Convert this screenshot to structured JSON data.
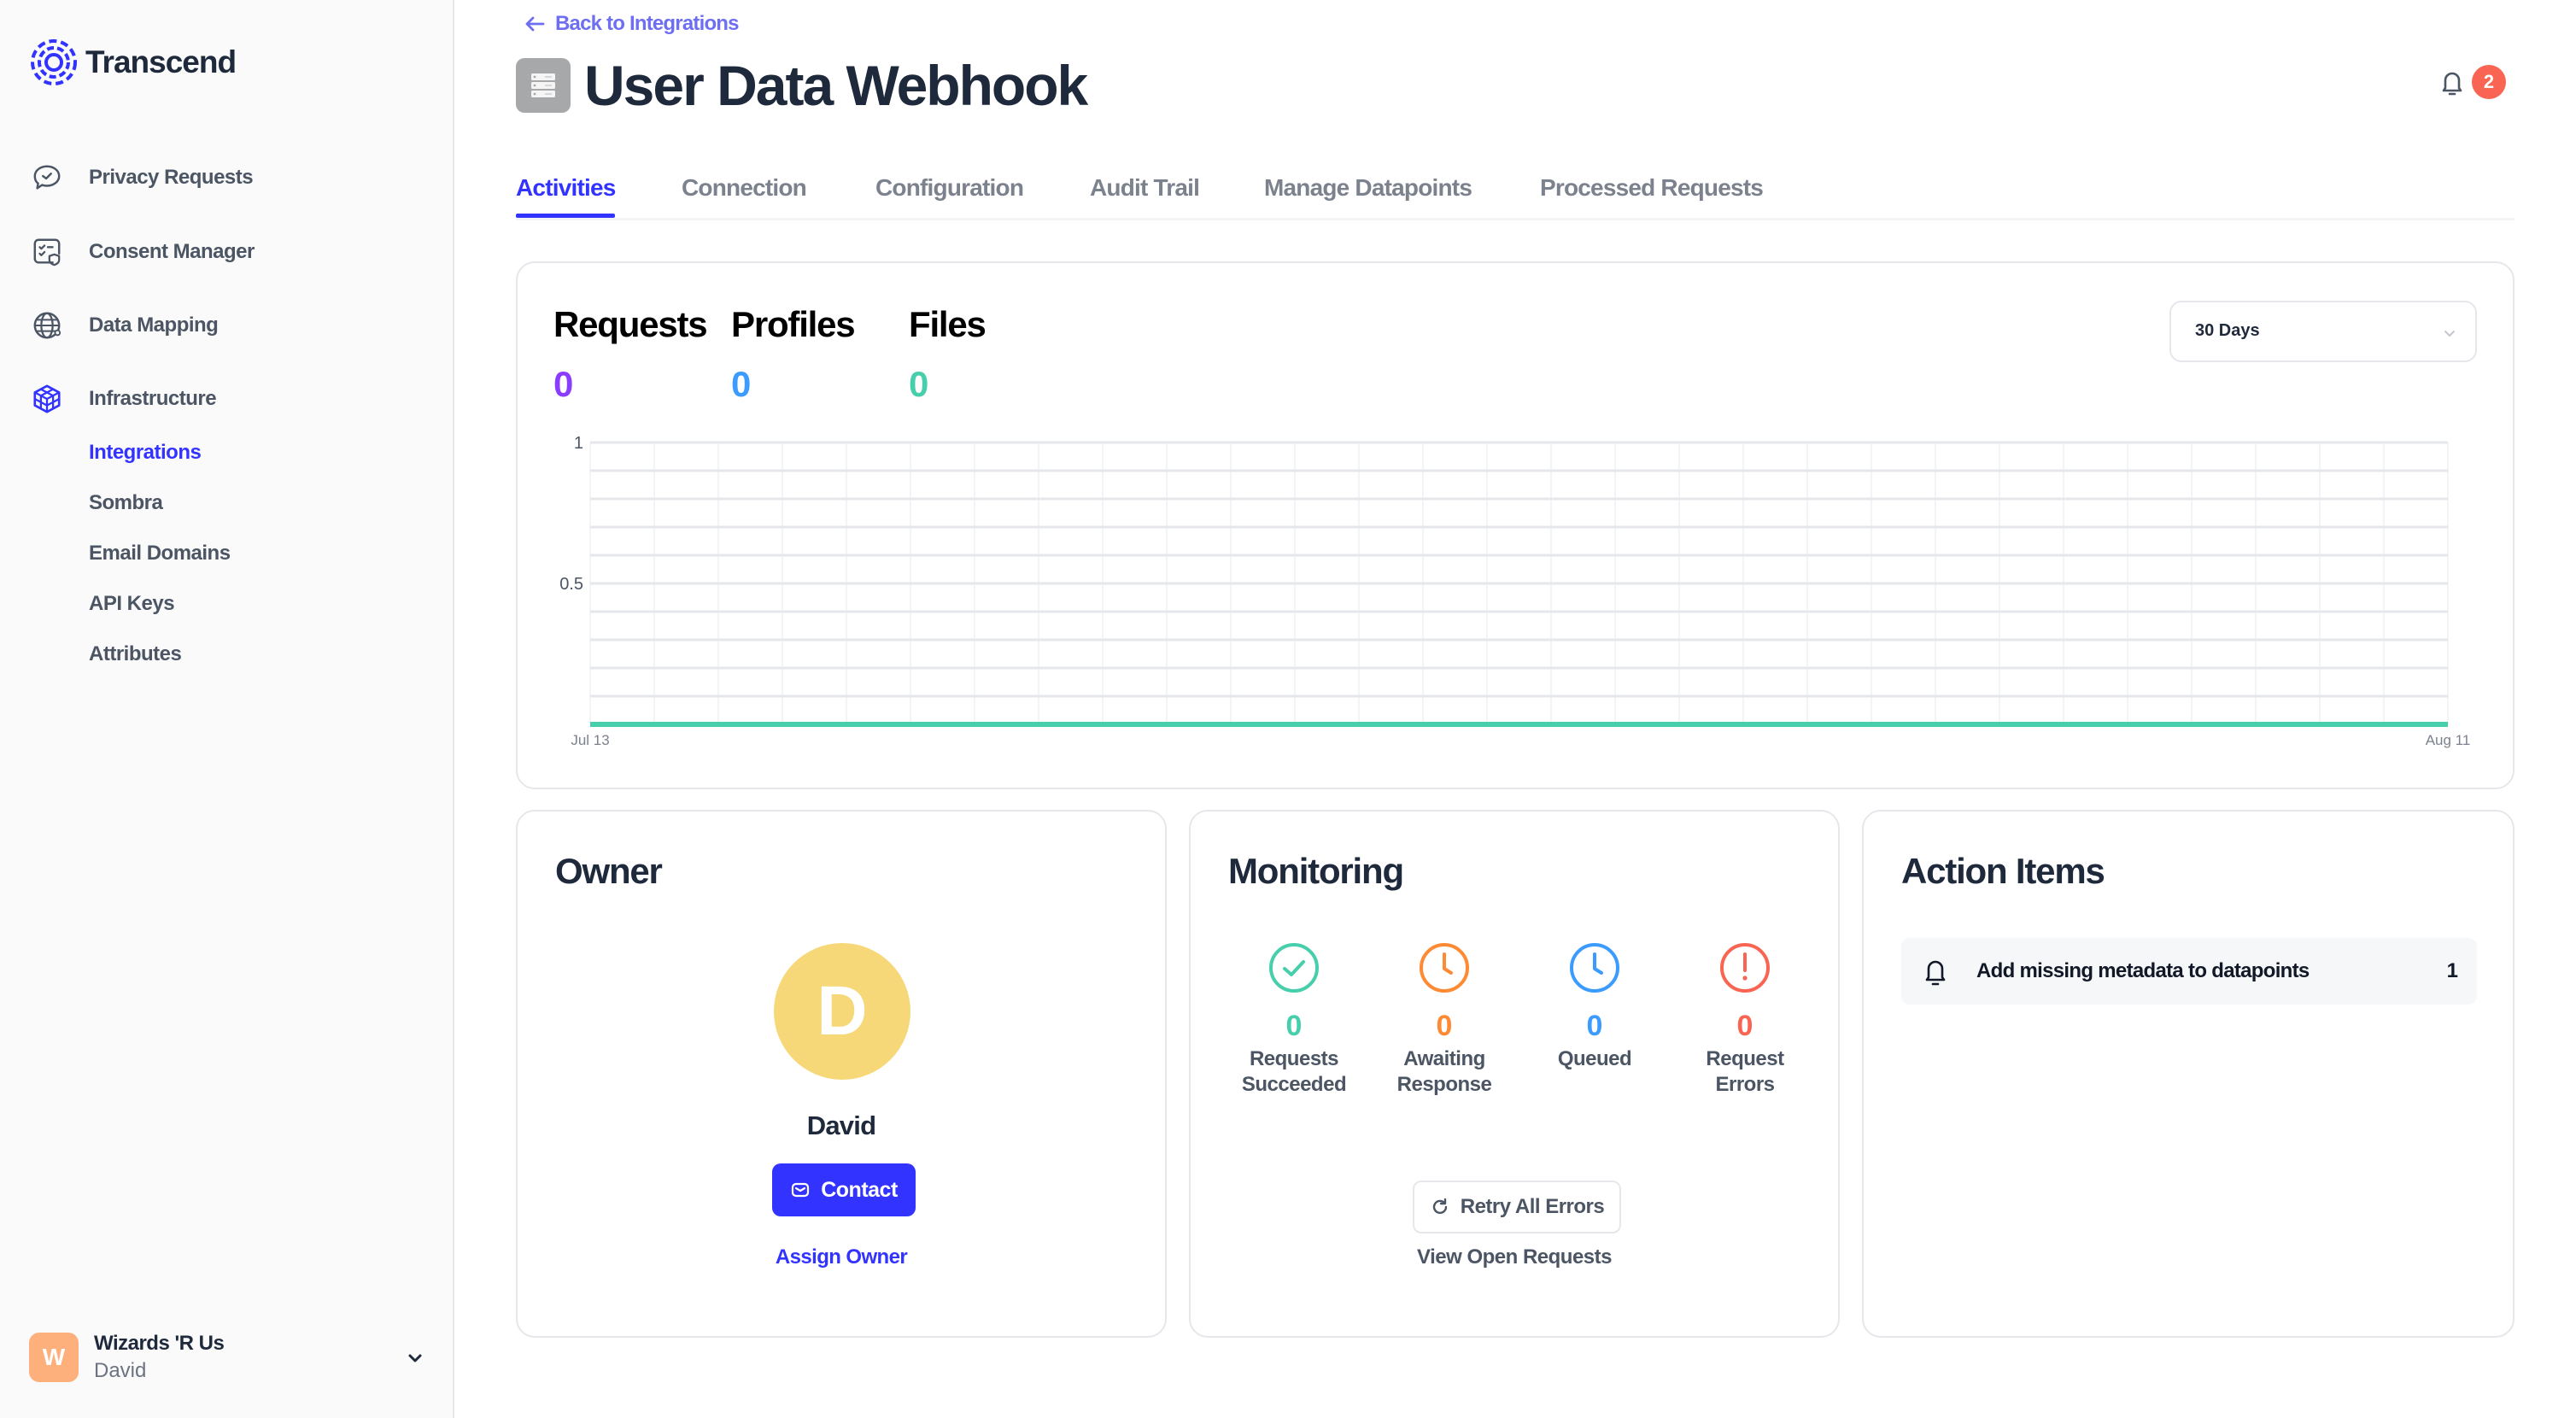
{
  "brand": {
    "name": "Transcend",
    "accent": "#3333ff"
  },
  "sidebar": {
    "items": [
      {
        "label": "Privacy Requests",
        "icon": "chat-check-icon"
      },
      {
        "label": "Consent Manager",
        "icon": "consent-shield-icon"
      },
      {
        "label": "Data Mapping",
        "icon": "globe-icon"
      },
      {
        "label": "Infrastructure",
        "icon": "cube-icon",
        "active": true
      }
    ],
    "subitems": [
      {
        "label": "Integrations",
        "active": true
      },
      {
        "label": "Sombra"
      },
      {
        "label": "Email Domains"
      },
      {
        "label": "API Keys"
      },
      {
        "label": "Attributes"
      }
    ],
    "org": {
      "initial": "W",
      "name": "Wizards 'R Us",
      "user": "David"
    }
  },
  "header": {
    "back_label": "Back to Integrations",
    "title": "User Data Webhook",
    "notifications_count": "2"
  },
  "tabs": [
    {
      "label": "Activities",
      "active": true
    },
    {
      "label": "Connection"
    },
    {
      "label": "Configuration"
    },
    {
      "label": "Audit Trail"
    },
    {
      "label": "Manage Datapoints"
    },
    {
      "label": "Processed Requests"
    }
  ],
  "activity": {
    "stats": [
      {
        "label": "Requests",
        "value": "0",
        "color": "#8b3dff"
      },
      {
        "label": "Profiles",
        "value": "0",
        "color": "#3b9bff"
      },
      {
        "label": "Files",
        "value": "0",
        "color": "#47cfac"
      }
    ],
    "range": {
      "selected": "30 Days"
    }
  },
  "chart_data": {
    "type": "line",
    "title": "",
    "xlabel": "",
    "ylabel": "",
    "x_start": "Jul 13",
    "x_end": "Aug 11",
    "x_tick_labels": [
      "Jul 13",
      "Aug 11"
    ],
    "num_days": 30,
    "ylim": [
      0,
      1
    ],
    "y_tick_labels": [
      "1",
      "0.5"
    ],
    "y_ticks": [
      1,
      0.5
    ],
    "grid": true,
    "series": [
      {
        "name": "Files",
        "color": "#47cfac",
        "values": [
          0,
          0,
          0,
          0,
          0,
          0,
          0,
          0,
          0,
          0,
          0,
          0,
          0,
          0,
          0,
          0,
          0,
          0,
          0,
          0,
          0,
          0,
          0,
          0,
          0,
          0,
          0,
          0,
          0,
          0
        ]
      }
    ]
  },
  "owner": {
    "title": "Owner",
    "initial": "D",
    "name": "David",
    "contact_label": "Contact",
    "assign_label": "Assign Owner"
  },
  "monitoring": {
    "title": "Monitoring",
    "metrics": [
      {
        "value": "0",
        "label1": "Requests",
        "label2": "Succeeded",
        "color": "#47cfac",
        "icon": "check-circle-icon"
      },
      {
        "value": "0",
        "label1": "Awaiting",
        "label2": "Response",
        "color": "#ff8a34",
        "icon": "clock-icon"
      },
      {
        "value": "0",
        "label1": "Queued",
        "label2": "",
        "color": "#3b9bff",
        "icon": "clock-icon"
      },
      {
        "value": "0",
        "label1": "Request",
        "label2": "Errors",
        "color": "#f96552",
        "icon": "alert-circle-icon"
      }
    ],
    "retry_label": "Retry All Errors",
    "open_label": "View Open Requests"
  },
  "action_items": {
    "title": "Action Items",
    "items": [
      {
        "label": "Add missing metadata to datapoints",
        "count": "1"
      }
    ]
  }
}
